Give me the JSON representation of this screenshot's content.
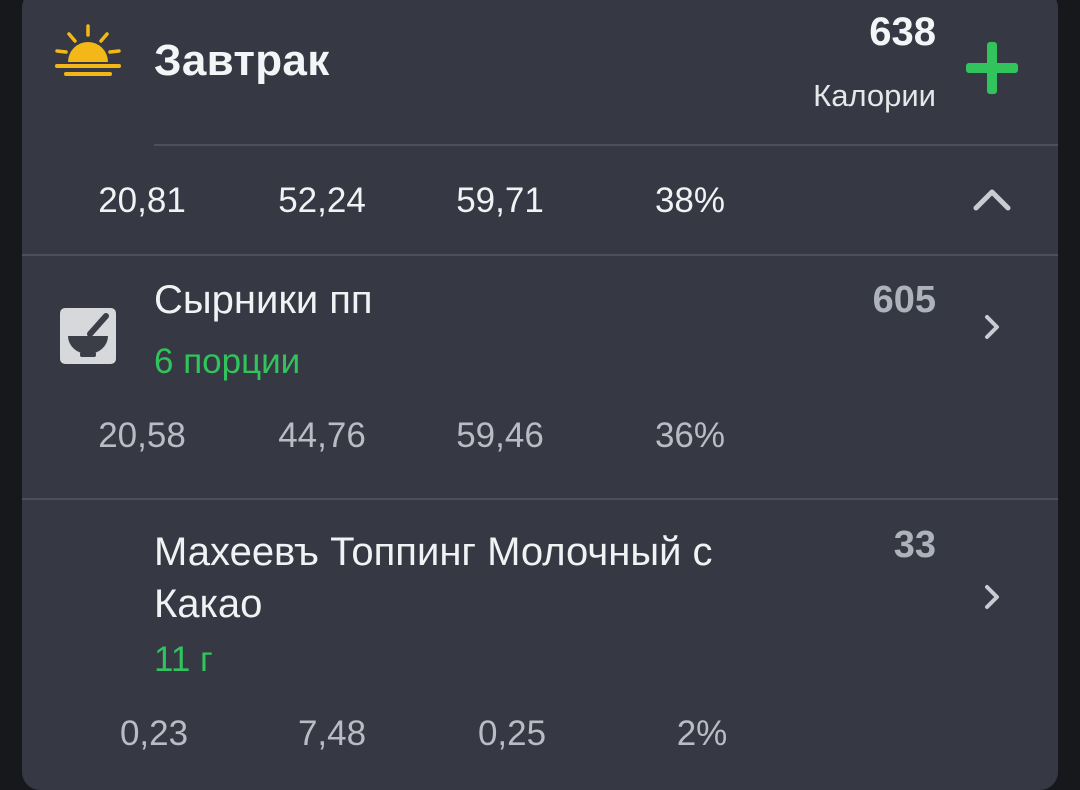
{
  "meal": {
    "title": "Завтрак",
    "calories": "638",
    "calories_label": "Калории",
    "icon": "sunrise-icon",
    "add_icon": "plus-icon",
    "summary": [
      "20,81",
      "52,24",
      "59,71",
      "38%"
    ],
    "collapse_icon": "chevron-up-icon"
  },
  "items": [
    {
      "name": "Сырники пп",
      "portion": "6 порции",
      "calories": "605",
      "nutrients": [
        "20,58",
        "44,76",
        "59,46",
        "36%"
      ],
      "icon": "recipe-mortar-icon"
    },
    {
      "name": "Махеевъ Топпинг Молочный с Какао",
      "portion": "11 г",
      "calories": "33",
      "nutrients": [
        "0,23",
        "7,48",
        "0,25",
        "2%"
      ]
    }
  ],
  "colors": {
    "background": "#17181c",
    "card": "#363943",
    "accent_green": "#31c35c",
    "sun_yellow": "#f3b718"
  }
}
